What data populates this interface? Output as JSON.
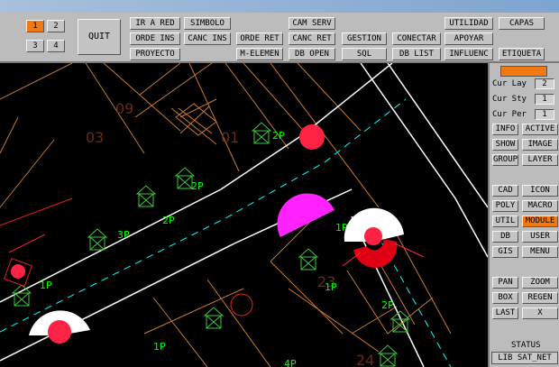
{
  "toolbar": {
    "numbers": [
      "1",
      "2",
      "3",
      "4"
    ],
    "active_number": "1",
    "quit": "QUIT",
    "buttons": {
      "ir_a_red": "IR A RED",
      "simbolo": "SIMBOLO",
      "cam_serv": "CAM SERV",
      "utilidad": "UTILIDAD",
      "capas": "CAPAS",
      "orde_ins": "ORDE INS",
      "canc_ins": "CANC INS",
      "orde_ret": "ORDE RET",
      "canc_ret": "CANC RET",
      "gestion": "GESTION",
      "conectar": "CONECTAR",
      "apoyar": "APOYAR",
      "proyecto": "PROYECTO",
      "m_elemen": "M-ELEMEN",
      "db_open": "DB OPEN",
      "sql": "SQL",
      "db_list": "DB LIST",
      "influenc": "INFLUENC",
      "etiqueta": "ETIQUETA"
    }
  },
  "panel": {
    "cur_layer_label": "Cur Lay",
    "cur_layer_value": "2",
    "cur_style_label": "Cur Sty",
    "cur_style_value": "1",
    "cur_pen_label": "Cur Per",
    "cur_pen_value": "1",
    "info": "INFO",
    "active": "ACTIVE",
    "show": "SHOW",
    "image": "IMAGE",
    "group": "GROUP",
    "layer": "LAYER",
    "cad": "CAD",
    "icon": "ICON",
    "poly": "POLY",
    "macro": "MACRO",
    "util": "UTIL",
    "module": "MODULE",
    "db": "DB",
    "user": "USER",
    "gis": "GIS",
    "menu": "MENU",
    "pan": "PAN",
    "zoom": "ZOOM",
    "box": "BOX",
    "regen": "REGEN",
    "last": "LAST",
    "x": "X",
    "status_label": "STATUS",
    "status_value": "LIB SAT_NET",
    "accent": "#f07a10"
  },
  "map": {
    "lot_numbers": [
      "09",
      "03",
      "01",
      "23",
      "24"
    ],
    "house_labels": [
      "2P",
      "2P",
      "2P",
      "3P",
      "1P",
      "1P",
      "2P",
      "1P",
      "1P",
      "4P"
    ],
    "colors": {
      "lot_lines": "#c87832",
      "street_lines": "#ffffff",
      "centerline": "#00ffff",
      "houses": "#3cc83c",
      "labels": "#00ff00",
      "marker": "#ff2244",
      "highlight": "#ff22ff"
    }
  }
}
